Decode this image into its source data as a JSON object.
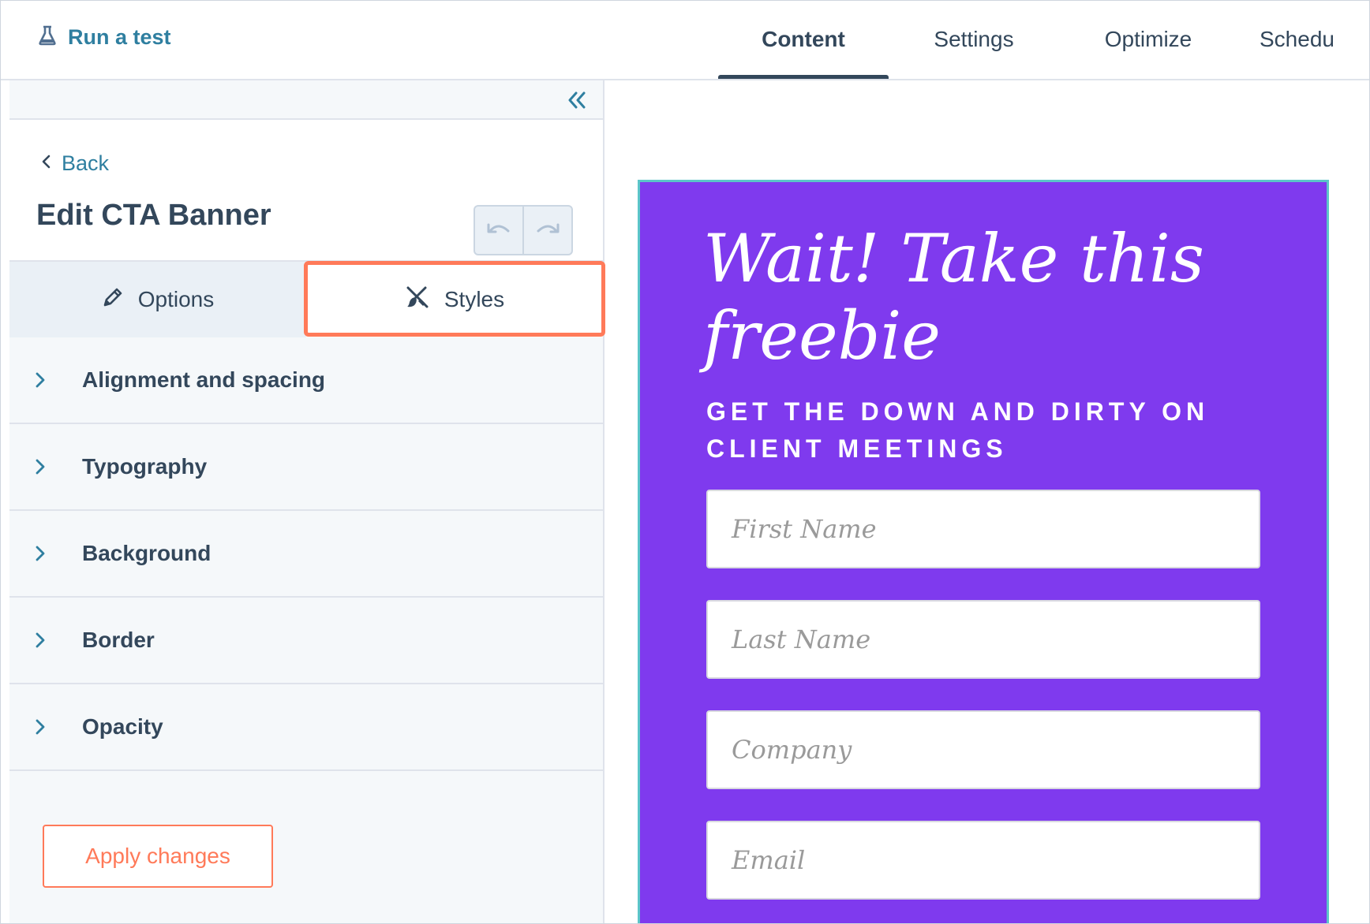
{
  "topbar": {
    "run_test_label": "Run a test",
    "tabs": [
      {
        "label": "Content",
        "active": true
      },
      {
        "label": "Settings",
        "active": false
      },
      {
        "label": "Optimize",
        "active": false
      },
      {
        "label": "Schedu",
        "active": false
      }
    ]
  },
  "panel": {
    "back_label": "Back",
    "title": "Edit CTA Banner",
    "subtabs": {
      "options_label": "Options",
      "styles_label": "Styles",
      "active": "styles"
    },
    "sections": [
      {
        "label": "Alignment and spacing"
      },
      {
        "label": "Typography"
      },
      {
        "label": "Background"
      },
      {
        "label": "Border"
      },
      {
        "label": "Opacity"
      }
    ],
    "apply_label": "Apply changes"
  },
  "preview": {
    "title": "Wait! Take this freebie",
    "subtitle": "GET THE DOWN AND DIRTY ON CLIENT MEETINGS",
    "fields": [
      {
        "placeholder": "First Name"
      },
      {
        "placeholder": "Last Name"
      },
      {
        "placeholder": "Company"
      },
      {
        "placeholder": "Email"
      }
    ]
  },
  "colors": {
    "accent": "#ff7a59",
    "link": "#2f7fa0",
    "banner_bg": "#7f3aee",
    "text": "#33475b"
  },
  "icons": {
    "run_test": "flask-icon",
    "collapse": "double-chevron-left-icon",
    "back": "chevron-left-icon",
    "undo": "undo-icon",
    "redo": "redo-icon",
    "options": "pencil-icon",
    "styles": "brush-crossed-icon",
    "section": "chevron-right-icon"
  }
}
